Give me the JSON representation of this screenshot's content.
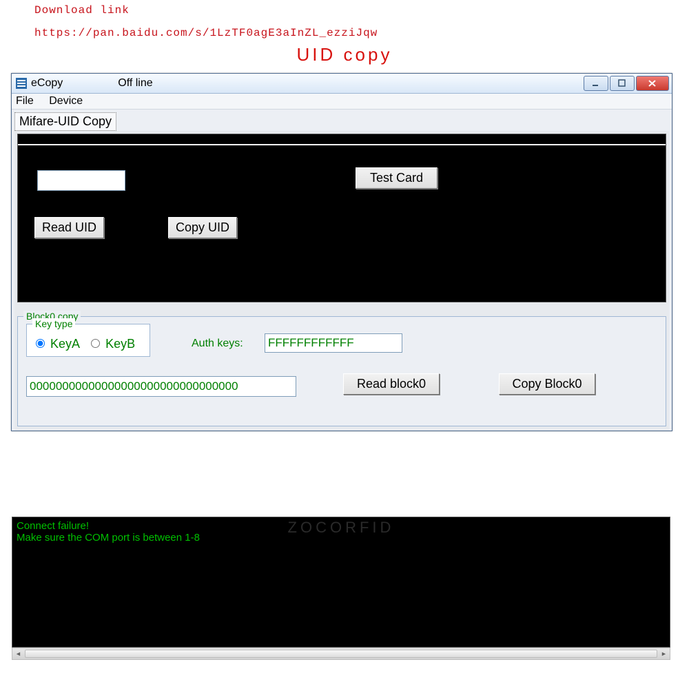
{
  "header": {
    "download_label": "Download link",
    "download_url": "https://pan.baidu.com/s/1LzTF0agE3aInZL_ezziJqw",
    "uid_copy_title": "UID copy"
  },
  "window": {
    "app_name": "eCopy",
    "status": "Off line",
    "menu": {
      "file": "File",
      "device": "Device"
    },
    "tab": "Mifare-UID Copy"
  },
  "uid_panel": {
    "uid_value": "",
    "read_uid": "Read UID",
    "copy_uid": "Copy UID",
    "test_card": "Test Card"
  },
  "block0": {
    "legend": "Block0 copy",
    "key_type_legend": "Key type",
    "keyA": "KeyA",
    "keyB": "KeyB",
    "auth_keys_label": "Auth keys:",
    "auth_keys_value": "FFFFFFFFFFFF",
    "block_data": "00000000000000000000000000000000",
    "read_block": "Read block0",
    "copy_block": "Copy Block0"
  },
  "console": {
    "watermark": "ZOCORFID",
    "line1": "Connect failure!",
    "line2": "Make sure the COM port is between 1-8"
  }
}
